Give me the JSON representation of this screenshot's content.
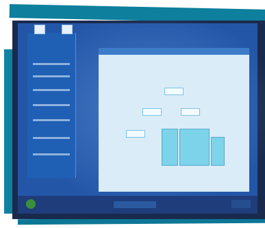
{
  "scene": {
    "description_visible_text": ""
  },
  "colors": {
    "frame_teal": "#0e7f9c",
    "screen_blue": "#2456a8",
    "window_light": "#d9ecf7"
  },
  "icons": [
    "start-orb-icon",
    "desktop-icon",
    "tray-icon"
  ]
}
